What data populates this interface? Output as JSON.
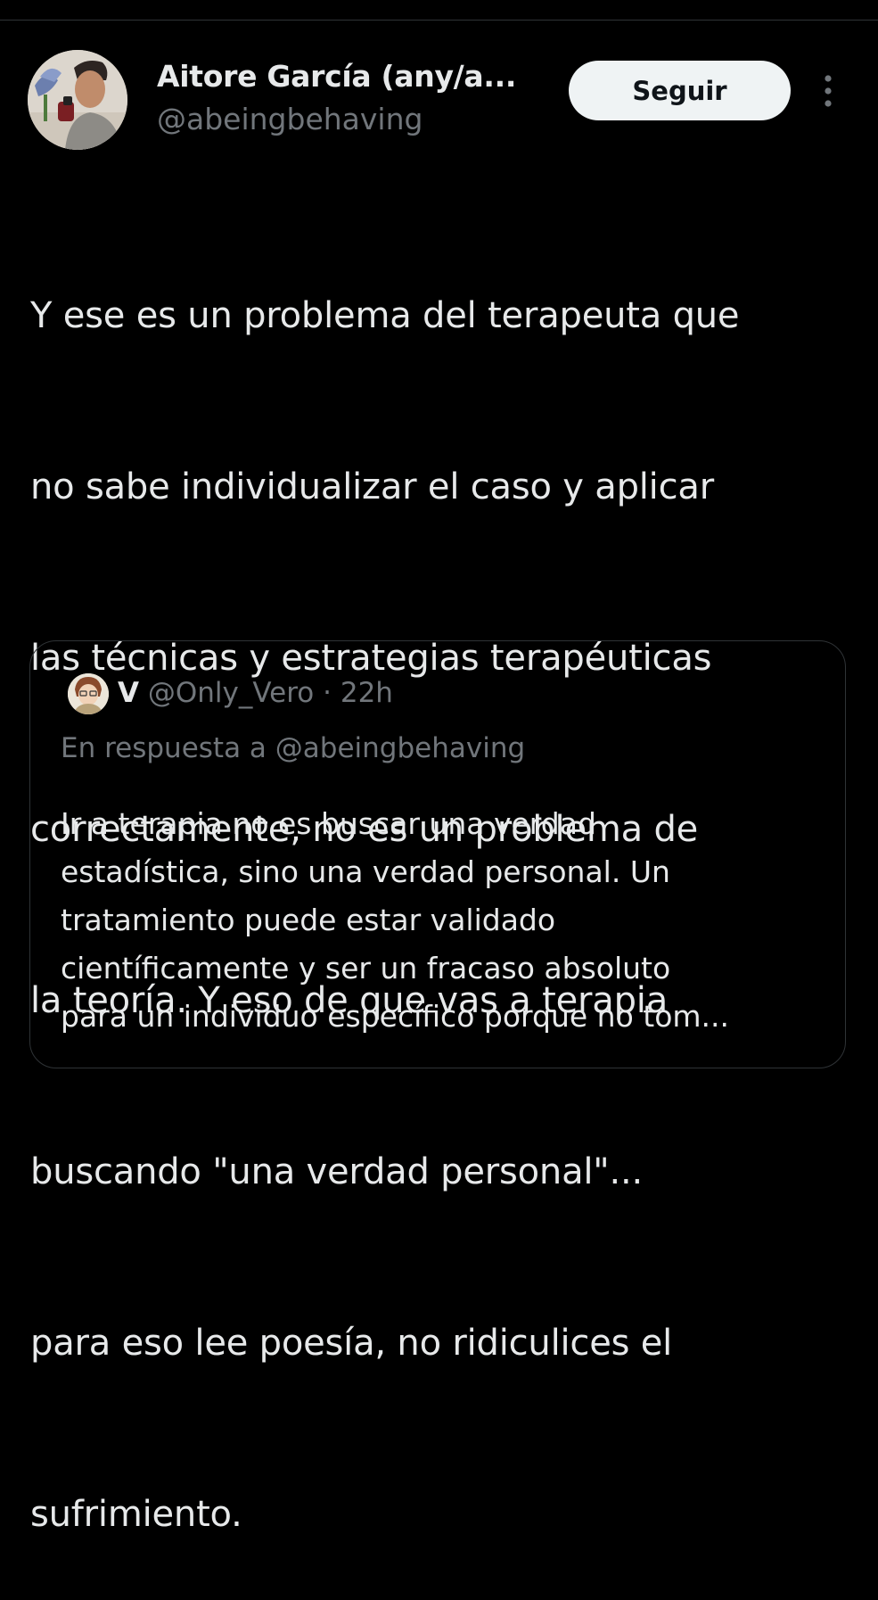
{
  "tweet": {
    "author_name": "Aitore García (any/a...",
    "author_handle": "@abeingbehaving",
    "follow_label": "Seguir",
    "text_lines": [
      "Y ese es un problema del terapeuta que",
      "no sabe individualizar el caso y aplicar",
      "las técnicas y estrategias terapéuticas",
      "correctamente, no es un problema de",
      "la teoría. Y eso de que vas a terapia",
      "buscando \"una verdad personal\"...",
      "para eso lee poesía, no ridiculices el",
      "sufrimiento."
    ]
  },
  "quote": {
    "name": "V",
    "handle": "@Only_Vero",
    "separator": "·",
    "time": "22h",
    "reply_to": "En respuesta a @abeingbehaving",
    "text_lines": [
      "Ir a terapia no es buscar una verdad",
      "estadística, sino una verdad personal. Un",
      "tratamiento puede estar validado",
      "científicamente y ser un fracaso absoluto",
      "para un individuo específico porque no tom..."
    ]
  },
  "icons": {
    "more": "more-vertical-icon"
  },
  "colors": {
    "background": "#000000",
    "primary_text": "#e7e9ea",
    "secondary_text": "#71767b",
    "border": "#2f3336",
    "follow_button_bg": "#eff3f4"
  }
}
